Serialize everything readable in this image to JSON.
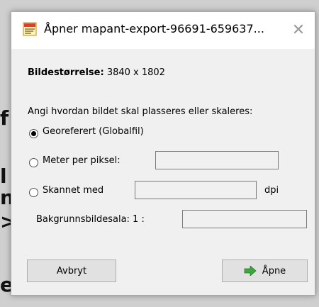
{
  "dialog": {
    "title": "Åpner mapant-export-96691-659637...",
    "close_icon": "close-icon",
    "app_icon": "app-icon"
  },
  "image_size": {
    "label": "Bildestørrelse:",
    "value": "3840 x 1802"
  },
  "placement": {
    "prompt": "Angi hvordan bildet skal plasseres eller skaleres:",
    "options": [
      {
        "label": "Georeferert (Globalfil)",
        "selected": true
      },
      {
        "label": "Meter per piksel:",
        "selected": false,
        "value": ""
      },
      {
        "label": "Skannet med",
        "selected": false,
        "value": "",
        "unit": "dpi"
      }
    ]
  },
  "background_scale": {
    "label": "Bakgrunnsbildesala: 1 :",
    "value": ""
  },
  "buttons": {
    "cancel": "Avbryt",
    "open": "Åpne"
  },
  "colors": {
    "arrow": "#3aa83a"
  }
}
